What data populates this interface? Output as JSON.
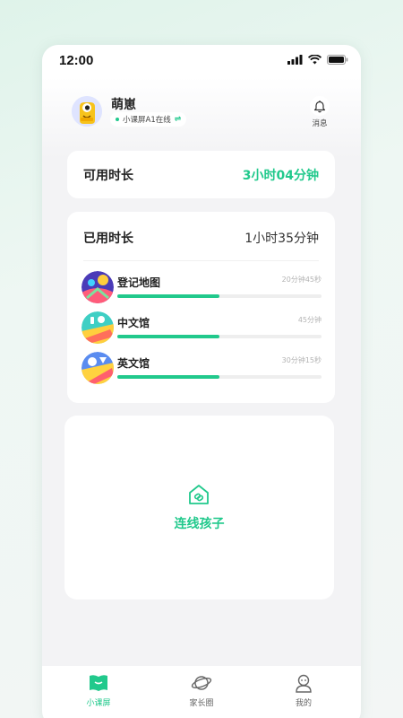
{
  "status_bar": {
    "time": "12:00"
  },
  "profile": {
    "name": "萌崽",
    "device_status": "小课屏A1在线"
  },
  "messages": {
    "label": "消息"
  },
  "available": {
    "label": "可用时长",
    "value": "3小时04分钟"
  },
  "used": {
    "label": "已用时长",
    "value": "1小时35分钟",
    "apps": [
      {
        "name": "登记地图",
        "time": "20分钟45秒",
        "progress": 0.5
      },
      {
        "name": "中文馆",
        "time": "45分钟",
        "progress": 0.5
      },
      {
        "name": "英文馆",
        "time": "30分钟15秒",
        "progress": 0.5
      }
    ]
  },
  "connect": {
    "label": "连线孩子"
  },
  "tabbar": {
    "tabs": [
      {
        "label": "小课屏",
        "icon": "book-icon",
        "active": true
      },
      {
        "label": "家长圈",
        "icon": "planet-icon",
        "active": false
      },
      {
        "label": "我的",
        "icon": "user-icon",
        "active": false
      }
    ]
  },
  "colors": {
    "accent": "#21c98c",
    "card": "#ffffff",
    "page": "#f3f3f5"
  }
}
